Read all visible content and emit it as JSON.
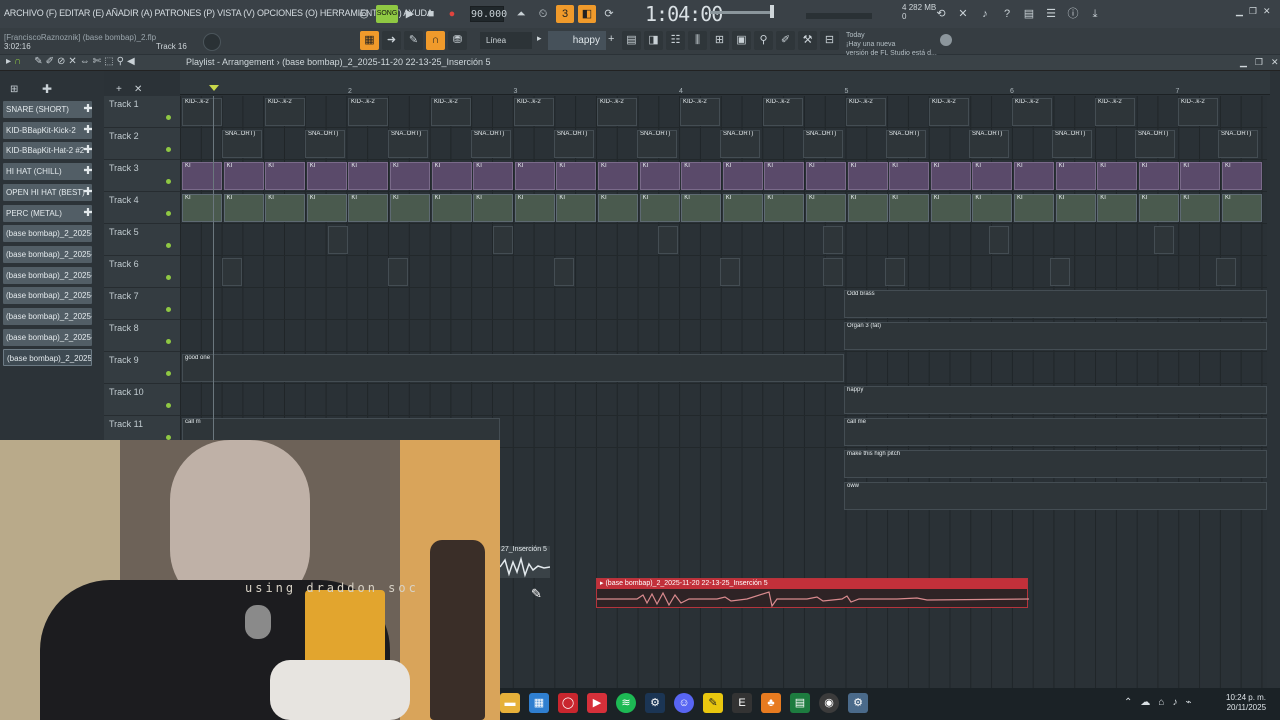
{
  "menu": "ARCHIVO (F) EDITAR (E) AÑADIR (A) PATRONES (P) VISTA (V) OPCIONES (O) HERRAMIENTAS (T) AYUDA",
  "hint_text": "[FranciscoRaznoznik] (base bombap)_2.flp",
  "time_small": "3:02:16",
  "track_label_small": "Track 16",
  "tempo": "90.000",
  "song_time": "1:04:00",
  "memory": {
    "num": "4",
    "mb": "282 MB",
    "cpu": "0"
  },
  "rec_badge": "SONG",
  "snap_label": "Línea",
  "pattern_name": "happy",
  "news": {
    "title": "Today",
    "line1": "¡Hay una nueva",
    "line2": "versión de FL Studio está d..."
  },
  "playlist": {
    "title": "Playlist - Arrangement",
    "separator": "›",
    "file": "(base bombap)_2_2025-11-20 22-13-25_Inserción 5",
    "ruler": [
      "2",
      "3",
      "4",
      "5",
      "6",
      "7"
    ]
  },
  "patterns": [
    {
      "label": "SNARE (SHORT)"
    },
    {
      "label": "KID-BBapKit-Kick-2"
    },
    {
      "label": "KID-BBapKit-Hat-2 #2"
    },
    {
      "label": "HI HAT (CHILL)"
    },
    {
      "label": "OPEN HI HAT (BEST)"
    },
    {
      "label": "PERC (METAL)"
    },
    {
      "label": "(base bombap)_2_2025-..."
    },
    {
      "label": "(base bombap)_2_2025-..."
    },
    {
      "label": "(base bombap)_2_2025-..."
    },
    {
      "label": "(base bombap)_2_2025-..."
    },
    {
      "label": "(base bombap)_2_2025-..."
    },
    {
      "label": "(base bombap)_2_2025-..."
    },
    {
      "label": "(base bombap)_2_2025-..."
    }
  ],
  "tracks": [
    "Track 1",
    "Track 2",
    "Track 3",
    "Track 4",
    "Track 5",
    "Track 6",
    "Track 7",
    "Track 8",
    "Track 9",
    "Track 10",
    "Track 11"
  ],
  "clip_labels": {
    "kick": "KID-..k-2",
    "snare": "SNA..ORT)",
    "hat": "KI",
    "odd_brass": "Odd brass",
    "organ": "Organ 3 (fat)",
    "good_one": "good one",
    "happy": "happy",
    "call_me_a": "call m",
    "call_me_b": "call me",
    "high_pitch": "make this high pitch",
    "oww": "oww",
    "small_clip": "27_Inserción 5",
    "red_clip": "(base bombap)_2_2025-11-20 22-13-25_Inserción 5"
  },
  "webcam_caption": "using draddon soc",
  "taskbar": {
    "time": "10:24 p. m.",
    "date": "20/11/2025"
  },
  "colors": {
    "accent": "#f09a2b",
    "record_red": "#c2303a",
    "track_dot": "#8fc843"
  }
}
